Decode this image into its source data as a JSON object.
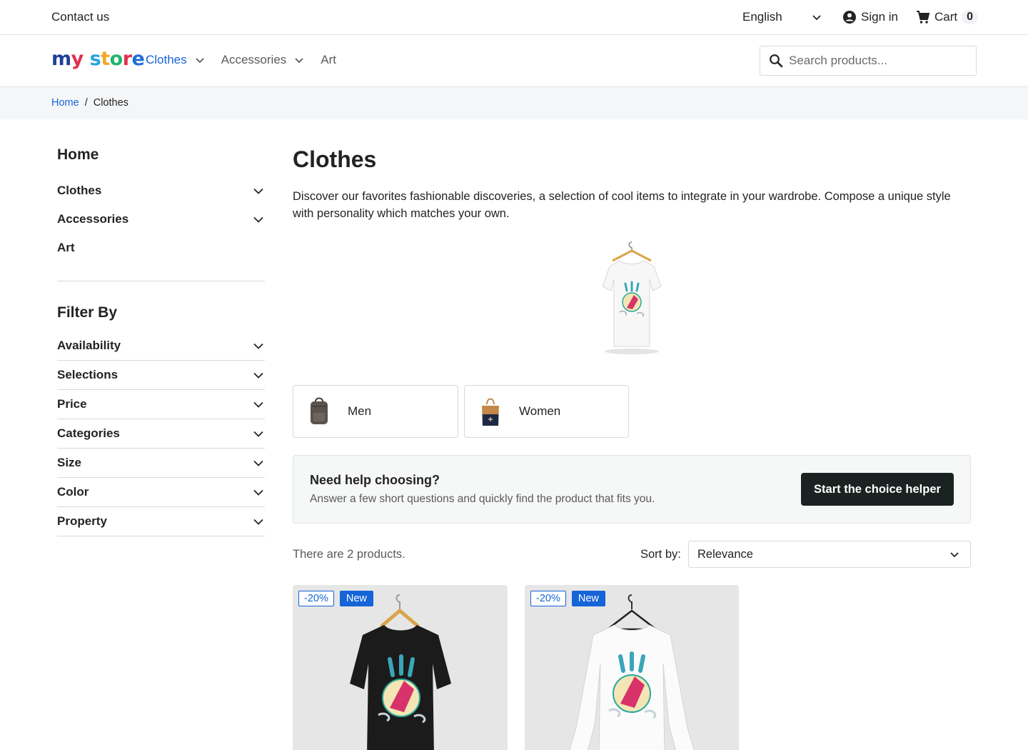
{
  "topbar": {
    "contact_label": "Contact us",
    "language": "English",
    "signin_label": "Sign in",
    "cart_label": "Cart",
    "cart_count": "0"
  },
  "header": {
    "logo_text": "my store",
    "nav": [
      {
        "label": "Clothes",
        "active": true,
        "has_dropdown": true
      },
      {
        "label": "Accessories",
        "active": false,
        "has_dropdown": true
      },
      {
        "label": "Art",
        "active": false,
        "has_dropdown": false
      }
    ],
    "search_placeholder": "Search products..."
  },
  "breadcrumb": [
    {
      "label": "Home",
      "link": true
    },
    {
      "label": "/",
      "link": false
    },
    {
      "label": "Clothes",
      "link": false
    }
  ],
  "sidebar": {
    "home_label": "Home",
    "categories": [
      {
        "label": "Clothes",
        "expandable": true
      },
      {
        "label": "Accessories",
        "expandable": true
      },
      {
        "label": "Art",
        "expandable": false
      }
    ],
    "filter_title": "Filter By",
    "filters": [
      "Availability",
      "Selections",
      "Price",
      "Categories",
      "Size",
      "Color",
      "Property"
    ]
  },
  "main": {
    "title": "Clothes",
    "description": "Discover our favorites fashionable discoveries, a selection of cool items to integrate in your wardrobe. Compose a unique style with personality which matches your own.",
    "subcategories": [
      "Men",
      "Women"
    ],
    "helper": {
      "title": "Need help choosing?",
      "subtitle": "Answer a few short questions and quickly find the product that fits you.",
      "button_label": "Start the choice helper"
    },
    "product_count": "There are 2 products.",
    "sort_label": "Sort by:",
    "sort_value": "Relevance",
    "products": [
      {
        "discount": "-20%",
        "flag": "New",
        "shirt_color": "#1b1b1b"
      },
      {
        "discount": "-20%",
        "flag": "New",
        "shirt_color": "#ffffff"
      }
    ]
  },
  "colors": {
    "accent": "#1565d8",
    "button_dark": "#1a2321",
    "breadcrumb_bg": "#f5f6f8"
  }
}
